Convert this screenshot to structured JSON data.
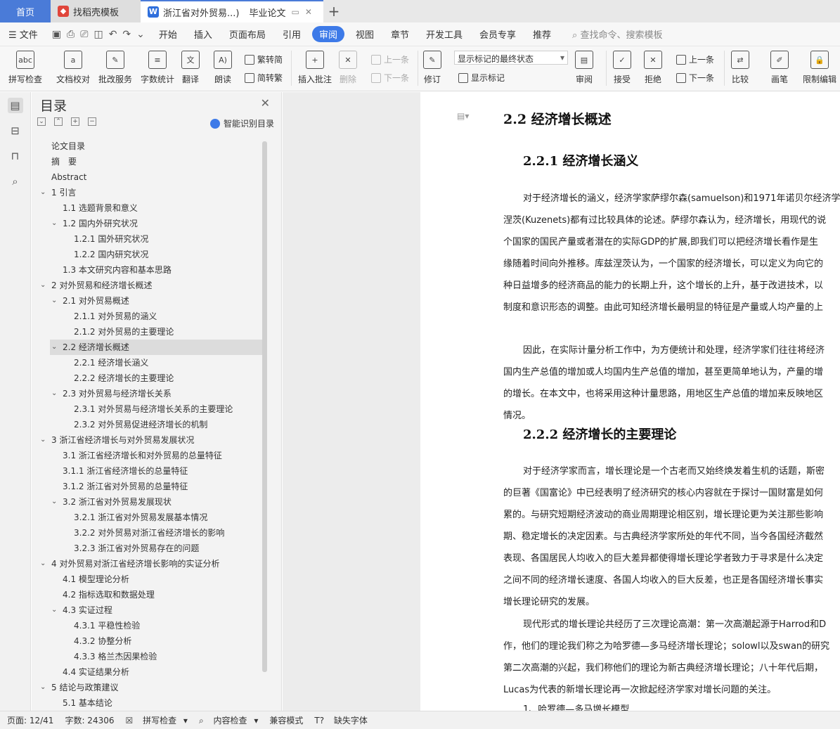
{
  "tabs": {
    "home": "首页",
    "template": "找稻壳模板",
    "doc_title": "浙江省对外贸易...)",
    "doc_tag": "毕业论文"
  },
  "menu": {
    "file": "文件",
    "items": [
      "开始",
      "插入",
      "页面布局",
      "引用",
      "审阅",
      "视图",
      "章节",
      "开发工具",
      "会员专享",
      "推荐"
    ],
    "active": "审阅",
    "search": "查找命令、搜索模板"
  },
  "ribbon": {
    "spell": "拼写检查",
    "proof": "文档校对",
    "batch": "批改服务",
    "wordcount": "字数统计",
    "translate": "翻译",
    "read": "朗读",
    "trad": "繁转简",
    "simp": "简转繁",
    "insert_comment": "插入批注",
    "delete": "删除",
    "prev_comment": "上一条",
    "next_comment": "下一条",
    "track": "修订",
    "markup_select": "显示标记的最终状态",
    "show_markup": "显示标记",
    "review": "审阅",
    "accept": "接受",
    "reject": "拒绝",
    "prev_change": "上一条",
    "next_change": "下一条",
    "compare": "比较",
    "pen": "画笔",
    "restrict": "限制编辑"
  },
  "toc": {
    "title": "目录",
    "smart_label": "智能识别目录",
    "items": [
      "论文目录",
      "摘　要",
      "Abstract",
      "1  引言",
      "1.1  选题背景和意义",
      "1.2  国内外研究状况",
      "1.2.1     国外研究状况",
      "1.2.2     国内研究状况",
      "1.3  本文研究内容和基本思路",
      "2  对外贸易和经济增长概述",
      "2.1  对外贸易概述",
      "2.1.1     对外贸易的涵义",
      "2.1.2 对外贸易的主要理论",
      "2.2 经济增长概述",
      "2.2.1 经济增长涵义",
      "2.2.2 经济增长的主要理论",
      "2.3 对外贸易与经济增长关系",
      "2.3.1 对外贸易与经济增长关系的主要理论",
      "2.3.2 对外贸易促进经济增长的机制",
      "3  浙江省经济增长与对外贸易发展状况",
      "3.1  浙江省经济增长和对外贸易的总量特征",
      "3.1.1 浙江省经济增长的总量特征",
      "3.1.2 浙江省对外贸易的总量特征",
      "3.2  浙江省对外贸易发展现状",
      "3.2.1 浙江省对外贸易发展基本情况",
      "3.2.2 对外贸易对浙江省经济增长的影响",
      "3.2.3 浙江省对外贸易存在的问题",
      "4  对外贸易对浙江省经济增长影响的实证分析",
      "4.1  模型理论分析",
      "4.2 指标选取和数据处理",
      "4.3 实证过程",
      "4.3.1 平稳性检验",
      "4.3.2 协整分析",
      "4.3.3 格兰杰因果检验",
      "4.4 实证结果分析",
      "5  结论与政策建议",
      "5.1 基本结论"
    ]
  },
  "page": {
    "h_2_2": "2.2 经济增长概述",
    "h_2_2_1": "2.2.1 经济增长涵义",
    "p1": [
      "对于经济增长的涵义，经济学家萨缪尔森(samuelson)和1971年诺贝尔经济学",
      "涅茨(Kuzenets)都有过比较具体的论述。萨缪尔森认为，经济增长，用现代的说",
      "个国家的国民产量或者潜在的实际GDP的扩展,即我们可以把经济增长看作是生",
      "缘随着时间向外推移。库兹涅茨认为，一个国家的经济增长，可以定义为向它的",
      "种日益增多的经济商品的能力的长期上升，这个增长的上升，基于改进技术，以",
      "制度和意识形态的调整。由此可知经济增长最明显的特征是产量或人均产量的上"
    ],
    "p2": [
      "因此，在实际计量分析工作中，为方便统计和处理，经济学家们往往将经济",
      "国内生产总值的增加或人均国内生产总值的增加，甚至更简单地认为，产量的增",
      "的增长。在本文中，也将采用这种计量思路，用地区生产总值的增加来反映地区",
      "情况。"
    ],
    "h_2_2_2": "2.2.2 经济增长的主要理论",
    "p3": [
      "对于经济学家而言，增长理论是一个古老而又始终焕发着生机的话题，斯密",
      "的巨著《国富论》中已经表明了经济研究的核心内容就在于探讨一国财富是如何",
      "累的。与研究短期经济波动的商业周期理论相区别，增长理论更为关注那些影响",
      "期、稳定增长的决定因素。与古典经济学家所处的年代不同，当今各国经济截然",
      "表现、各国居民人均收入的巨大差异都使得增长理论学者致力于寻求是什么决定",
      "之间不同的经济增长速度、各国人均收入的巨大反差，也正是各国经济增长事实",
      "增长理论研究的发展。"
    ],
    "p4": [
      "现代形式的增长理论共经历了三次理论高潮：第一次高潮起源于Harrod和D",
      "作，他们的理论我们称之为哈罗德—多马经济增长理论；solowl以及swan的研究",
      "第二次高潮的兴起，我们称他们的理论为新古典经济增长理论；八十年代后期，",
      "Lucas为代表的新增长理论再一次掀起经济学家对增长问题的关注。"
    ],
    "p5": "1、哈罗德—多马增长模型"
  },
  "status": {
    "page": "页面: 12/41",
    "words": "字数: 24306",
    "spell": "拼写检查",
    "content": "内容检查",
    "compat": "兼容模式",
    "missing_font": "缺失字体"
  }
}
